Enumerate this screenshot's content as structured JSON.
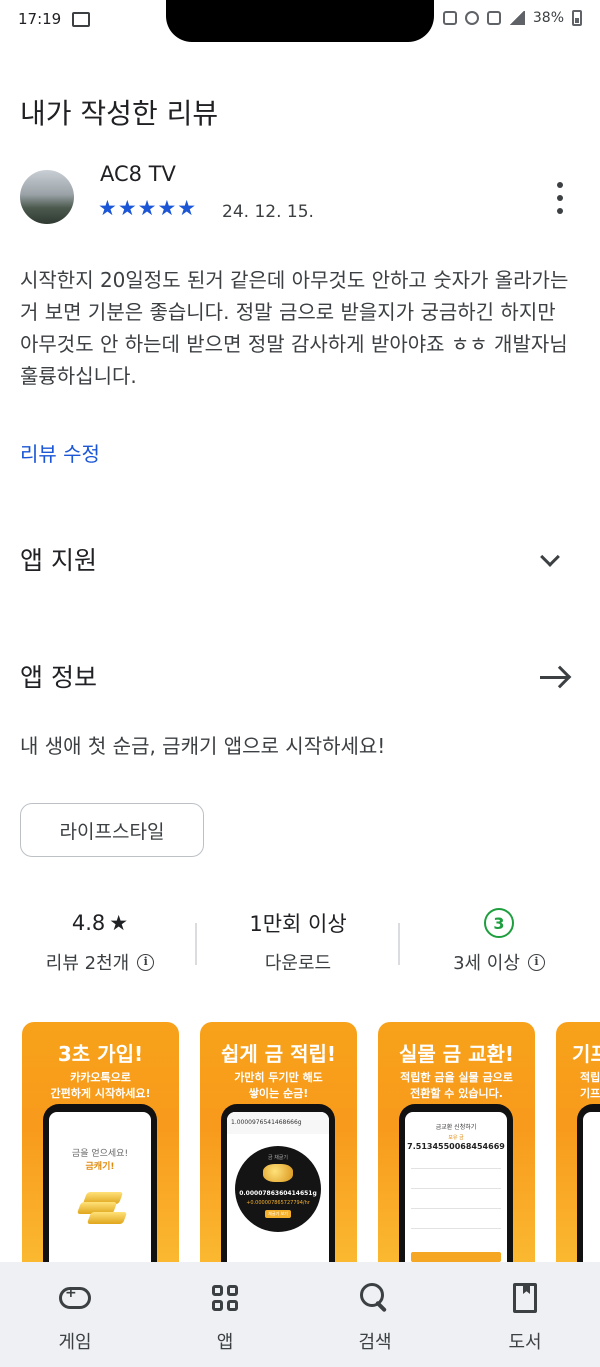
{
  "status_bar": {
    "time": "17:19",
    "battery": "38%"
  },
  "page": {
    "title": "내가 작성한 리뷰"
  },
  "review": {
    "author": "AC8 TV",
    "stars": "★★★★★",
    "rating": 5,
    "date": "24. 12. 15.",
    "body": "시작한지 20일정도 된거 같은데 아무것도 안하고 숫자가 올라가는거 보면 기분은 좋습니다. 정말 금으로 받을지가 궁금하긴 하지만 아무것도 안 하는데 받으면 정말 감사하게 받아야죠 ㅎㅎ 개발자님 훌륭하십니다.",
    "edit_label": "리뷰 수정"
  },
  "sections": {
    "support": "앱 지원",
    "info": "앱 정보"
  },
  "app": {
    "description": "내 생애 첫 순금, 금캐기 앱으로 시작하세요!",
    "category": "라이프스타일"
  },
  "stats": {
    "rating_value": "4.8",
    "rating_star": "★",
    "reviews_label": "리뷰 2천개",
    "downloads_value": "1만회 이상",
    "downloads_label": "다운로드",
    "age_badge": "3",
    "age_label": "3세 이상",
    "info_glyph": "i"
  },
  "screenshots": [
    {
      "title": "3초 가입!",
      "subtitle": "카카오톡으로\n간편하게 시작하세요!",
      "screen_text": "금을 얻으세요!",
      "screen_brand": "금캐기!"
    },
    {
      "title": "쉽게 금 적립!",
      "subtitle": "가만히 두기만 해도\n쌓이는 순금!",
      "screen_top": "1.0000976541468666g",
      "screen_label": "금 채굴기",
      "screen_value": "0.0000786360414651g",
      "screen_rate": "+0.000007865727794/hr",
      "screen_button": "채굴기 보기"
    },
    {
      "title": "실물 금 교환!",
      "subtitle": "적립한 금을 실물 금으로\n전환할 수 있습니다.",
      "screen_head": "금교환 신청하기",
      "screen_sub": "보유 금",
      "screen_value": "7.5134550068454669"
    },
    {
      "title": "기프",
      "subtitle": "적립\n기프"
    }
  ],
  "bottom_nav": [
    {
      "label": "게임",
      "icon": "gamepad-icon"
    },
    {
      "label": "앱",
      "icon": "apps-grid-icon"
    },
    {
      "label": "검색",
      "icon": "search-icon"
    },
    {
      "label": "도서",
      "icon": "book-icon"
    }
  ],
  "colors": {
    "link": "#1a56d6",
    "star": "#1a56d6",
    "age_badge": "#1e9e3e",
    "screenshot_bg": "#f7a21a",
    "nav_bg": "#eef0f4"
  }
}
